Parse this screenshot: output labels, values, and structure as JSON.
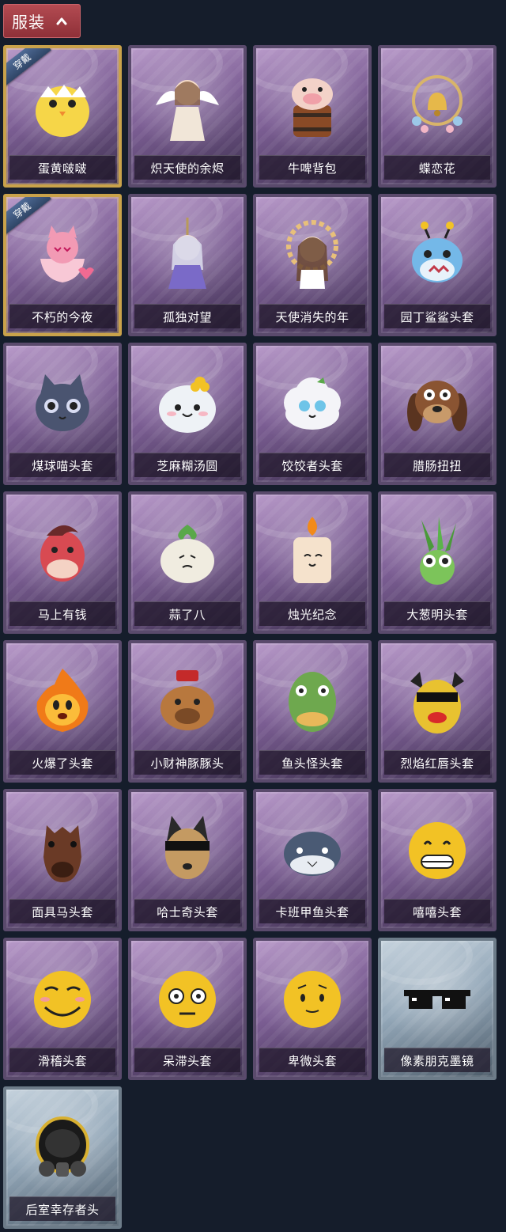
{
  "section": {
    "title": "服装",
    "icon": "chevron-up-icon"
  },
  "items": [
    {
      "name": "蛋黄啵啵",
      "equipped": true,
      "equip_label": "穿戴",
      "rarity": "purple",
      "art": "egg-chick",
      "color": "#f6d648"
    },
    {
      "name": "炽天使的余烬",
      "equipped": false,
      "rarity": "purple",
      "art": "angel-figure",
      "color": "#f1e6d8"
    },
    {
      "name": "牛啤背包",
      "equipped": false,
      "rarity": "purple",
      "art": "cow-barrel",
      "color": "#f3d2c8"
    },
    {
      "name": "蝶恋花",
      "equipped": false,
      "rarity": "purple",
      "art": "bell-charm",
      "color": "#e6b84a"
    },
    {
      "name": "不朽的今夜",
      "equipped": true,
      "equip_label": "穿戴",
      "rarity": "purple",
      "art": "pink-fox-cup",
      "color": "#f29ab4"
    },
    {
      "name": "孤独对望",
      "equipped": false,
      "rarity": "purple",
      "art": "doll-charm",
      "color": "#d8d8ea"
    },
    {
      "name": "天使消失的年",
      "equipped": false,
      "rarity": "purple",
      "art": "halo-doll",
      "color": "#e8c07a"
    },
    {
      "name": "园丁鲨鲨头套",
      "equipped": false,
      "rarity": "purple",
      "art": "shark-bee",
      "color": "#74b8e8"
    },
    {
      "name": "煤球喵头套",
      "equipped": false,
      "rarity": "purple",
      "art": "cat-head",
      "color": "#4a5470"
    },
    {
      "name": "芝麻糊汤圆",
      "equipped": false,
      "rarity": "purple",
      "art": "dumpling",
      "color": "#eef2f6"
    },
    {
      "name": "饺饺者头套",
      "equipped": false,
      "rarity": "purple",
      "art": "cloud-head",
      "color": "#f4f4f8"
    },
    {
      "name": "腊肠扭扭",
      "equipped": false,
      "rarity": "purple",
      "art": "dog-head",
      "color": "#8a5432"
    },
    {
      "name": "马上有钱",
      "equipped": false,
      "rarity": "purple",
      "art": "red-horse",
      "color": "#d84a52"
    },
    {
      "name": "蒜了八",
      "equipped": false,
      "rarity": "purple",
      "art": "garlic",
      "color": "#f0ece0"
    },
    {
      "name": "烛光纪念",
      "equipped": false,
      "rarity": "purple",
      "art": "candle",
      "color": "#f5e2cc"
    },
    {
      "name": "大葱明头套",
      "equipped": false,
      "rarity": "purple",
      "art": "scallion",
      "color": "#7cc45a"
    },
    {
      "name": "火爆了头套",
      "equipped": false,
      "rarity": "purple",
      "art": "fire-ball",
      "color": "#f07a18"
    },
    {
      "name": "小财神豚豚头",
      "equipped": false,
      "rarity": "purple",
      "art": "capybara",
      "color": "#b8783e"
    },
    {
      "name": "鱼头怪头套",
      "equipped": false,
      "rarity": "purple",
      "art": "fish-mask",
      "color": "#6ea84e"
    },
    {
      "name": "烈焰红唇头套",
      "equipped": false,
      "rarity": "purple",
      "art": "yellow-mask",
      "color": "#e8c230"
    },
    {
      "name": "面具马头套",
      "equipped": false,
      "rarity": "purple",
      "art": "horse-mask",
      "color": "#6a3a26"
    },
    {
      "name": "哈士奇头套",
      "equipped": false,
      "rarity": "purple",
      "art": "husky",
      "color": "#c49a62"
    },
    {
      "name": "卡班甲鱼头套",
      "equipped": false,
      "rarity": "purple",
      "art": "round-fish",
      "color": "#4a5a74"
    },
    {
      "name": "嘻嘻头套",
      "equipped": false,
      "rarity": "purple",
      "art": "grin-emoji",
      "color": "#f2c225"
    },
    {
      "name": "滑稽头套",
      "equipped": false,
      "rarity": "purple",
      "art": "smirk-emoji",
      "color": "#f2c225"
    },
    {
      "name": "呆滞头套",
      "equipped": false,
      "rarity": "purple",
      "art": "stare-emoji",
      "color": "#f2c225"
    },
    {
      "name": "卑微头套",
      "equipped": false,
      "rarity": "purple",
      "art": "humble-emoji",
      "color": "#f2c225"
    },
    {
      "name": "像素朋克墨镜",
      "equipped": false,
      "rarity": "blue",
      "art": "pixel-glasses",
      "color": "#111111"
    },
    {
      "name": "后室幸存者头",
      "equipped": false,
      "rarity": "blue",
      "art": "gas-mask",
      "color": "#222222"
    }
  ]
}
